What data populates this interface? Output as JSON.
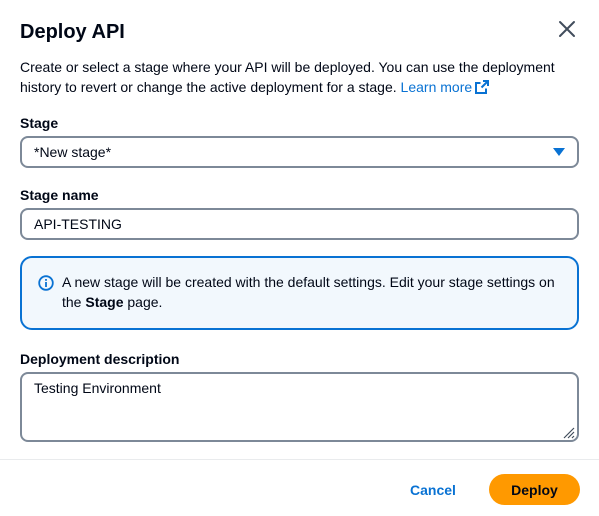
{
  "dialog": {
    "title": "Deploy API",
    "description": "Create or select a stage where your API will be deployed. You can use the deployment history to revert or change the active deployment for a stage.",
    "learn_more": "Learn more"
  },
  "stage": {
    "label": "Stage",
    "selected": "*New stage*"
  },
  "stage_name": {
    "label": "Stage name",
    "value": "API-TESTING"
  },
  "alert": {
    "text_before": "A new stage will be created with the default settings. Edit your stage settings on the ",
    "bold": "Stage",
    "text_after": " page."
  },
  "deployment_description": {
    "label": "Deployment description",
    "value": "Testing Environment"
  },
  "footer": {
    "cancel_label": "Cancel",
    "deploy_label": "Deploy"
  },
  "colors": {
    "link": "#0972d3",
    "primary_button": "#ff9900",
    "info_border": "#0972d3",
    "info_background": "#f2f8fd",
    "input_border": "#7d8998"
  },
  "icons": {
    "close": "close-icon",
    "external_link": "external-link-icon",
    "dropdown": "caret-down-icon",
    "info": "info-icon",
    "resize": "resize-grip-icon"
  }
}
